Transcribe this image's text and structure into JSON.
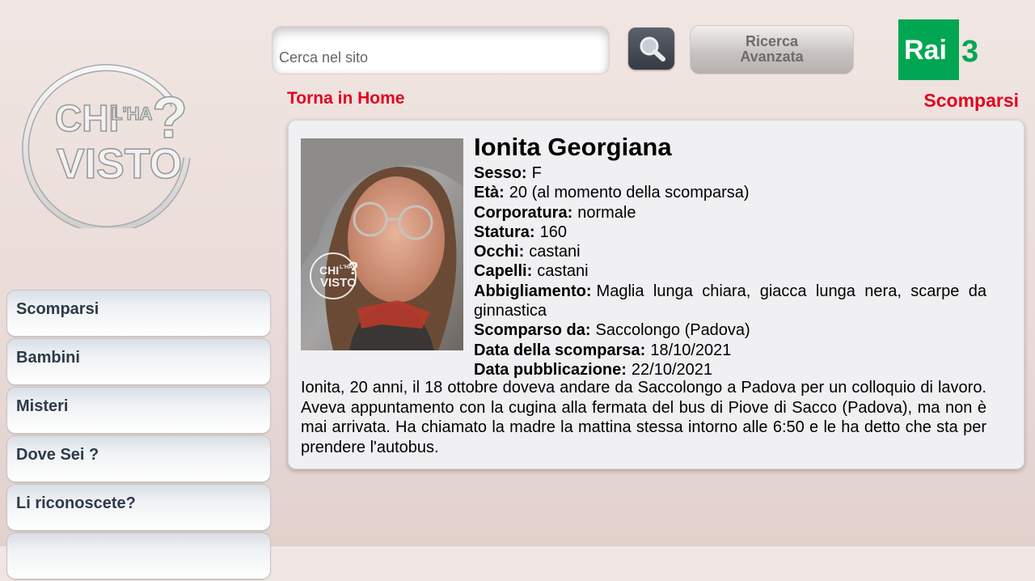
{
  "header": {
    "logo_text": [
      "CHI",
      "L'HA",
      "VISTO",
      "?"
    ],
    "search": {
      "placeholder": "Cerca nel sito",
      "value": ""
    },
    "search_button_icon": "magnifier-icon",
    "advanced_search": {
      "line1": "Ricerca",
      "line2": "Avanzata"
    },
    "channel_logo": {
      "text": "Rai",
      "number": "3",
      "color": "#00a651"
    },
    "home_link": "Torna in Home",
    "section_title": "Scomparsi"
  },
  "sidebar": {
    "items": [
      {
        "label": "Scomparsi"
      },
      {
        "label": "Bambini"
      },
      {
        "label": "Misteri"
      },
      {
        "label": "Dove Sei ?"
      },
      {
        "label": "Li riconoscete?"
      }
    ]
  },
  "person": {
    "name": "Ionita Georgiana",
    "fields": [
      {
        "label": "Sesso:",
        "value": "F"
      },
      {
        "label": "Età:",
        "value": "20 (al momento della scomparsa)"
      },
      {
        "label": "Corporatura:",
        "value": "normale"
      },
      {
        "label": "Statura:",
        "value": "160"
      },
      {
        "label": "Occhi:",
        "value": "castani"
      },
      {
        "label": "Capelli:",
        "value": "castani"
      },
      {
        "label": "Abbigliamento:",
        "value": "Maglia lunga chiara, giacca lunga nera, scarpe da ginnastica"
      },
      {
        "label": "Scomparso da:",
        "value": "Saccolongo (Padova)"
      },
      {
        "label": "Data della scomparsa:",
        "value": "18/10/2021"
      },
      {
        "label": "Data pubblicazione:",
        "value": "22/10/2021"
      }
    ],
    "description": "Ionita, 20 anni, il 18 ottobre doveva andare da Saccolongo a Padova per un colloquio di lavoro. Aveva appuntamento con la cugina alla fermata del bus di Piove di Sacco (Padova), ma non è mai arrivata. Ha chiamato la madre la mattina stessa intorno alle 6:50 e le ha detto che sta per prendere l'autobus.",
    "photo_watermark": [
      "CHI",
      "L'HA",
      "VISTO",
      "?"
    ]
  },
  "colors": {
    "accent_red": "#e4001f",
    "menu_text": "#2e3a48",
    "rai_green": "#00a651"
  }
}
